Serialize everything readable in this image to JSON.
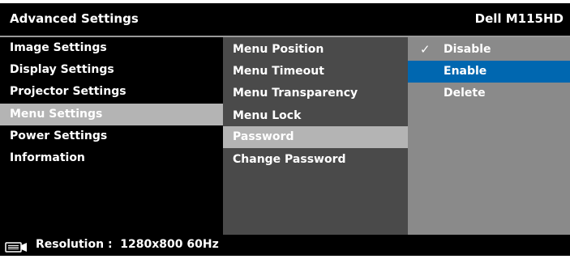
{
  "header": {
    "title": "Advanced Settings",
    "model": "Dell M115HD"
  },
  "main_menu": [
    {
      "label": "Image Settings"
    },
    {
      "label": "Display Settings"
    },
    {
      "label": "Projector Settings"
    },
    {
      "label": "Menu Settings",
      "active": true
    },
    {
      "label": "Power Settings"
    },
    {
      "label": "Information"
    }
  ],
  "sub_menu": [
    {
      "label": "Menu Position"
    },
    {
      "label": "Menu Timeout"
    },
    {
      "label": "Menu Transparency"
    },
    {
      "label": "Menu Lock"
    },
    {
      "label": "Password",
      "active": true
    },
    {
      "label": "Change Password"
    }
  ],
  "options": [
    {
      "label": "Disable",
      "checked": true
    },
    {
      "label": "Enable",
      "highlighted": true
    },
    {
      "label": "Delete"
    }
  ],
  "footer": {
    "resolution_label": "Resolution :",
    "resolution_value": "1280x800 60Hz",
    "icon": "resolution-icon"
  },
  "colors": {
    "background": "#000000",
    "sub_panel": "#4a4a4a",
    "option_panel": "#8a8a8a",
    "selection": "#b4b4b4",
    "highlight": "#0067b0"
  }
}
